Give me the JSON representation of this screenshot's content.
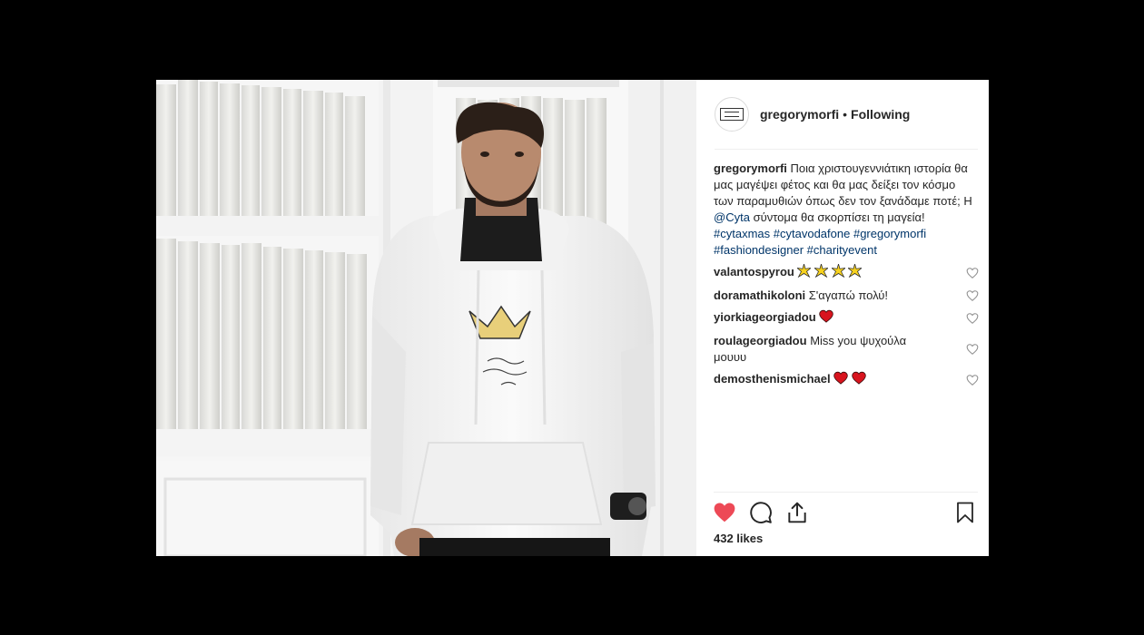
{
  "post": {
    "username": "gregorymorfi",
    "follow_status": "Following",
    "separator": "•"
  },
  "caption": {
    "username": "gregorymorfi",
    "text_before_mention": "Ποια χριστουγεννιάτικη ιστορία θα μας μαγέψει φέτος και θα μας δείξει τον κόσμο των παραμυθιών όπως δεν τον ξανάδαμε ποτέ; Η",
    "mention": "@Cyta",
    "text_after_mention": "σύντομα θα σκορπίσει τη μαγεία!",
    "hashtags": [
      "#cytaxmas",
      "#cytavodafone",
      "#gregorymorfi",
      "#fashiondesigner",
      "#charityevent"
    ]
  },
  "comments": [
    {
      "username": "valantospyrou",
      "text": "",
      "emoji": [
        "sparkle-star",
        "sparkle-star",
        "sparkle-star",
        "sparkle-star"
      ]
    },
    {
      "username": "doramathikoloni",
      "text": "Σ'αγαπώ πολύ!",
      "emoji": []
    },
    {
      "username": "yiorkiageorgiadou",
      "text": "",
      "emoji": [
        "red-heart"
      ]
    },
    {
      "username": "roulageorgiadou",
      "text": "Miss you ψυχούλα μουυυ",
      "emoji": []
    },
    {
      "username": "demosthenismichael",
      "text": "",
      "emoji": [
        "red-heart",
        "red-heart"
      ]
    }
  ],
  "likes": "432 likes",
  "colors": {
    "heart_liked": "#ed4956",
    "link": "#003569",
    "text": "#262626",
    "backdrop": "#000000"
  },
  "icons": [
    "heart-icon",
    "comment-icon",
    "share-icon",
    "bookmark-icon"
  ]
}
